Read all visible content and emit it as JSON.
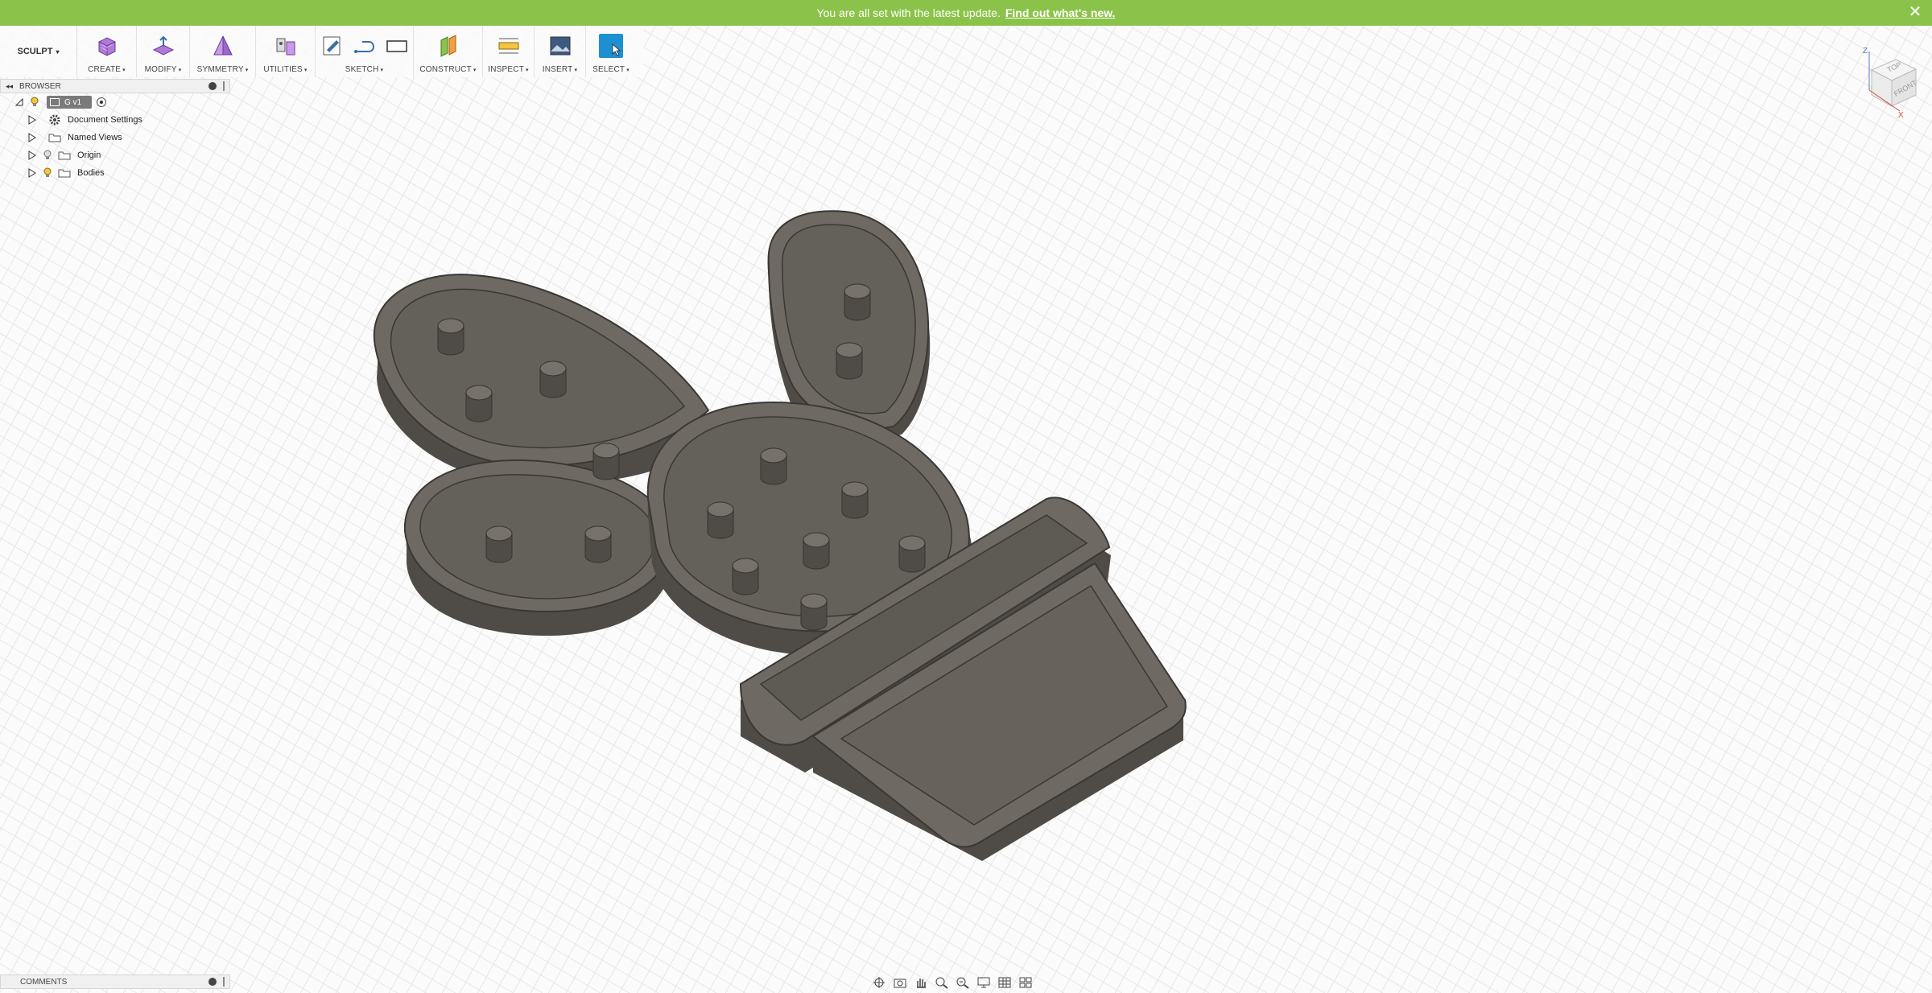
{
  "notification": {
    "message": "You are all set with the latest update.",
    "link": "Find out what's new.",
    "close": "✕"
  },
  "toolbar": {
    "workspace": "SCULPT",
    "groups": [
      {
        "label": "CREATE"
      },
      {
        "label": "MODIFY"
      },
      {
        "label": "SYMMETRY"
      },
      {
        "label": "UTILITIES"
      },
      {
        "label": "SKETCH"
      },
      {
        "label": "CONSTRUCT"
      },
      {
        "label": "INSPECT"
      },
      {
        "label": "INSERT"
      },
      {
        "label": "SELECT"
      }
    ],
    "caret": "▾"
  },
  "browser": {
    "title": "BROWSER",
    "collapse": "◂◂",
    "root": "G v1",
    "items": [
      {
        "label": "Document Settings"
      },
      {
        "label": "Named Views"
      },
      {
        "label": "Origin"
      },
      {
        "label": "Bodies"
      }
    ]
  },
  "comments": {
    "title": "COMMENTS"
  },
  "viewcube": {
    "top": "TOP",
    "front": "FRONT",
    "z": "Z",
    "x": "X"
  },
  "colors": {
    "notification": "#8bc34a",
    "select_accent": "#1e8fd0",
    "model_top": "#6e6a63",
    "model_side": "#4f4c47",
    "grid": "#e3e3e3"
  }
}
